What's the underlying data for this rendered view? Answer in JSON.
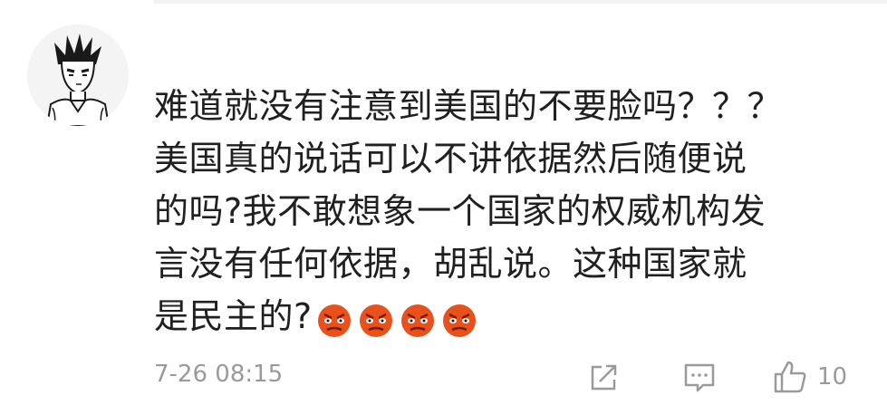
{
  "comment": {
    "lines": [
      "难道就没有注意到美国的不要脸吗？？？",
      "美国真的说话可以不讲依据然后随便说",
      "的吗?我不敢想象一个国家的权威机构发",
      "言没有任何依据，胡乱说。这种国家就",
      "是民主的?"
    ],
    "emoji_icons": [
      "angry-face-icon",
      "angry-face-icon",
      "angry-face-icon",
      "angry-face-icon"
    ],
    "timestamp": "7-26 08:15",
    "like_count": "10"
  },
  "colors": {
    "text": "#202020",
    "meta": "#9a9a9a",
    "emoji": "#e8501c"
  }
}
